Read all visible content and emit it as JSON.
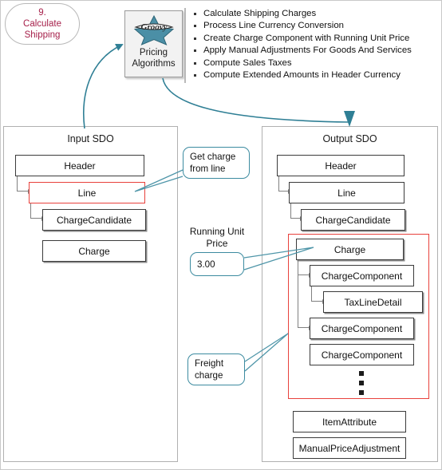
{
  "step_badge": {
    "number": "9.",
    "line1": "Calculate",
    "line2": "Shipping"
  },
  "algorithm_box": {
    "logo_alt": "groovy-star-logo",
    "label_line1": "Pricing",
    "label_line2": "Algorithms"
  },
  "bullets": [
    "Calculate Shipping Charges",
    "Process Line Currency  Conversion",
    "Create Charge  Component with Running Unit Price",
    "Apply Manual Adjustments For Goods And Services",
    "Compute Sales Taxes",
    "Compute Extended Amounts in Header Currency"
  ],
  "input_panel": {
    "title": "Input SDO",
    "nodes": [
      {
        "label": "Header"
      },
      {
        "label": "Line"
      },
      {
        "label": "ChargeCandidate"
      },
      {
        "label": "Charge"
      }
    ]
  },
  "output_panel": {
    "title": "Output SDO",
    "nodes": [
      {
        "label": "Header"
      },
      {
        "label": "Line"
      },
      {
        "label": "ChargeCandidate"
      },
      {
        "label": "Charge"
      },
      {
        "label": "ChargeComponent"
      },
      {
        "label": "TaxLineDetail"
      },
      {
        "label": "ChargeComponent"
      },
      {
        "label": "ChargeComponent"
      },
      {
        "label": "ItemAttribute"
      },
      {
        "label": "ManualPriceAdjustment"
      }
    ]
  },
  "callouts": {
    "get_charge": {
      "line1": "Get charge",
      "line2": "from line"
    },
    "running_unit_price_label": {
      "line1": "Running Unit",
      "line2": "Price"
    },
    "running_unit_price_value": "3.00",
    "freight": {
      "line1": "Freight",
      "line2": "charge"
    }
  },
  "colors": {
    "accent_teal": "#3c8ba0",
    "highlight_red": "#e8413c",
    "badge_text": "#a6204a",
    "connector_gray": "#808080"
  }
}
